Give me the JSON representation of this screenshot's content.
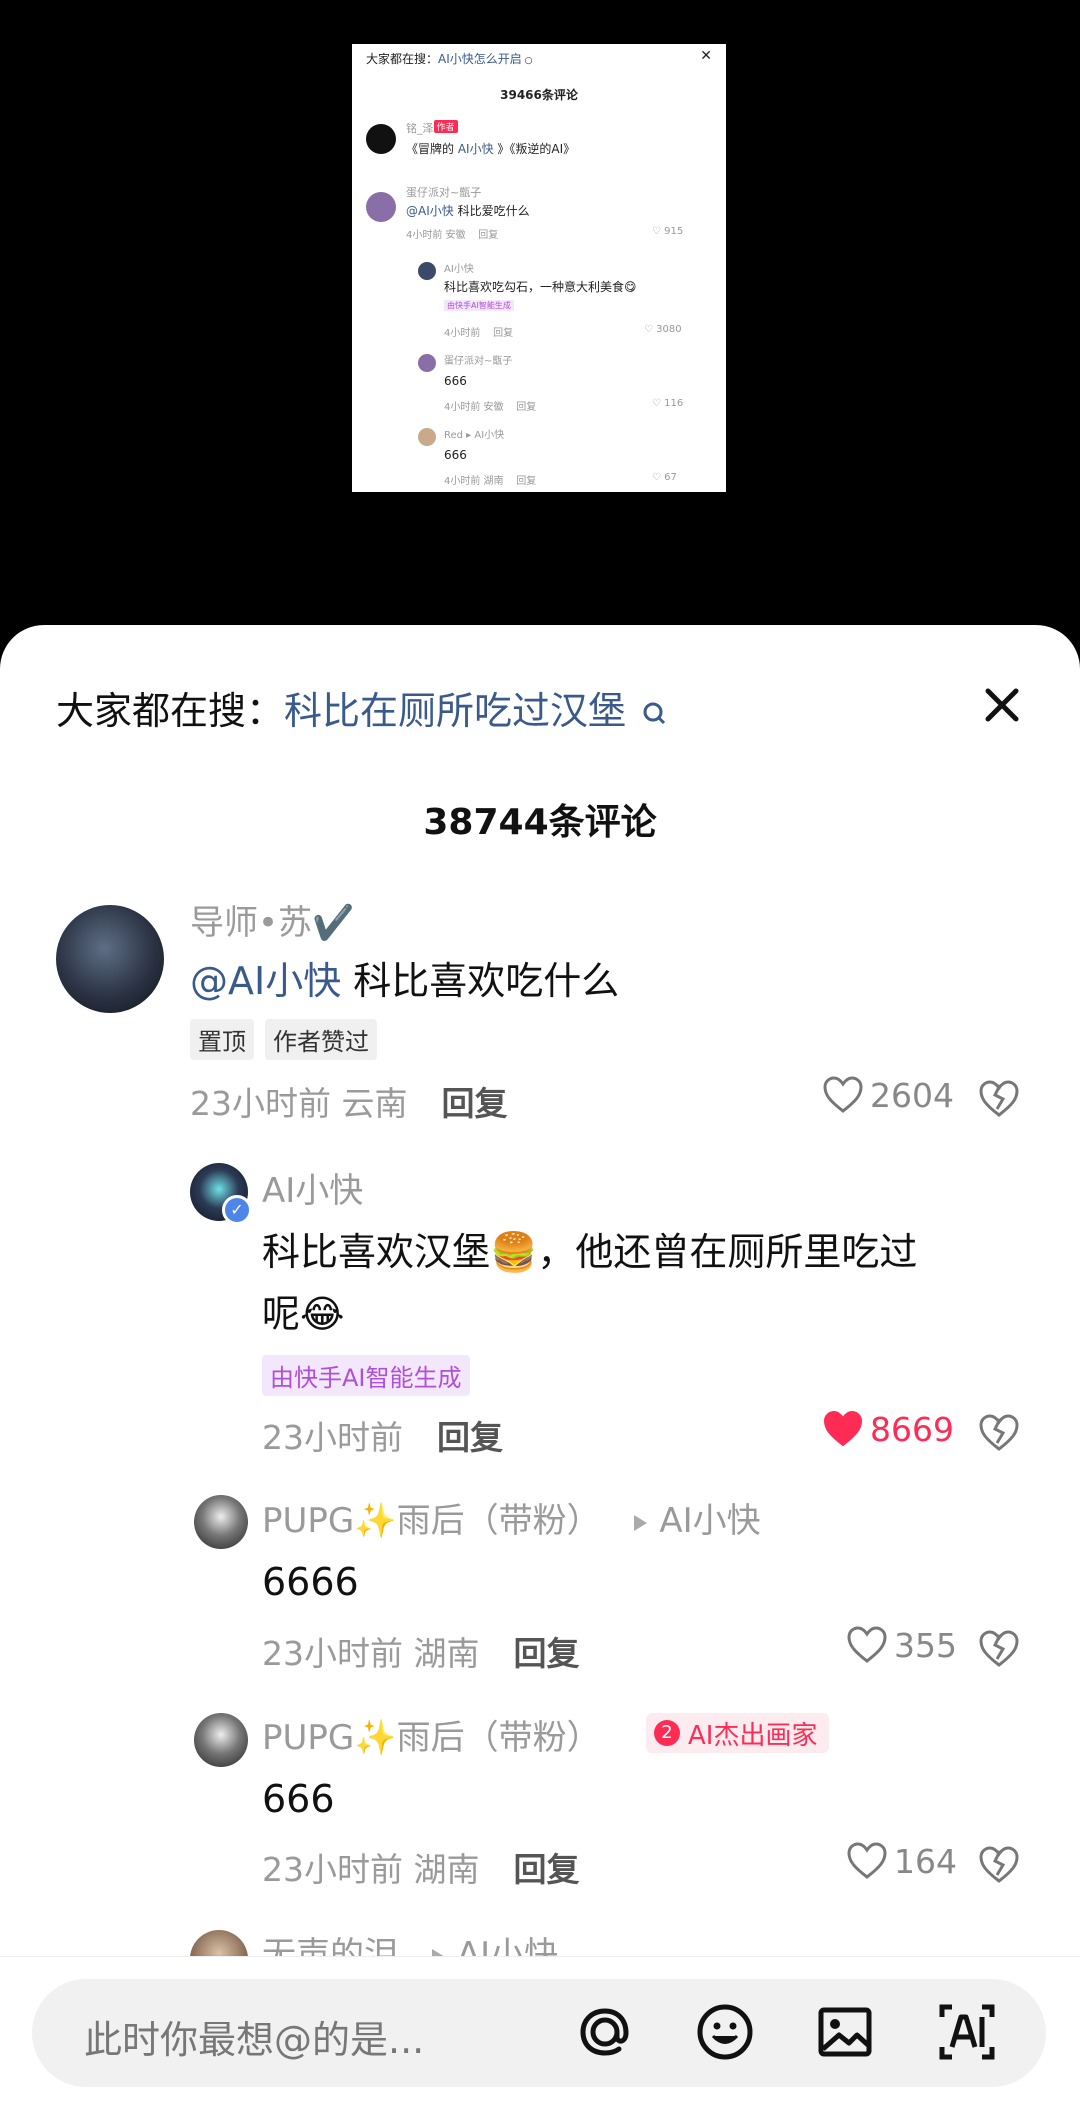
{
  "mini": {
    "search_label": "大家都在搜：",
    "search_keyword": "AI小快怎么开启",
    "count": "39466条评论",
    "c1": {
      "name": "铭_泽",
      "tag": "作者",
      "text_a": "《冒牌的 ",
      "text_kw": "AI小快",
      "text_b": " 》《叛逆的AI》"
    },
    "c2": {
      "name": "蛋仔派对~甑子",
      "mention": "@AI小快",
      "text": " 科比爱吃什么",
      "time": "4小时前 安徽",
      "reply": "回复",
      "likes": "915"
    },
    "c3": {
      "name": "AI小快",
      "text": "科比喜欢吃勾石，一种意大利美食😋",
      "badge": "由快手AI智能生成",
      "time": "4小时前",
      "reply": "回复",
      "likes": "3080"
    },
    "c4": {
      "name": "蛋仔派对~甑子",
      "text": "666",
      "time": "4小时前 安徽",
      "reply": "回复",
      "likes": "116"
    },
    "c5": {
      "name": "Red",
      "to": "AI小快",
      "text": "666",
      "time": "4小时前 湖南",
      "reply": "回复",
      "likes": "67"
    }
  },
  "header": {
    "search_label": "大家都在搜：",
    "search_keyword": "科比在厕所吃过汉堡",
    "comment_count": "38744条评论"
  },
  "comments": {
    "c1": {
      "name": "导师•苏✔️",
      "mention": "@AI小快",
      "text": " 科比喜欢吃什么",
      "tag_pin": "置顶",
      "tag_liked": "作者赞过",
      "time": "23小时前",
      "location": "云南",
      "reply": "回复",
      "likes": "2604"
    },
    "c2": {
      "name": "AI小快",
      "line1": "科比喜欢汉堡🍔，他还曾在厕所里吃过",
      "line2": "呢😂",
      "badge": "由快手AI智能生成",
      "time": "23小时前",
      "reply": "回复",
      "likes": "8669"
    },
    "c3": {
      "name": "PUPG✨雨后（带粉）",
      "to": "AI小快",
      "text": "6666",
      "time": "23小时前",
      "location": "湖南",
      "reply": "回复",
      "likes": "355"
    },
    "c4": {
      "name": "PUPG✨雨后（带粉）",
      "badge_num": "2",
      "badge": "AI杰出画家",
      "text": "666",
      "time": "23小时前",
      "location": "湖南",
      "reply": "回复",
      "likes": "164"
    },
    "c5": {
      "name": "无声的泪",
      "to": "AI小快"
    }
  },
  "input": {
    "placeholder": "此时你最想@的是..."
  },
  "icons": [
    "search-icon",
    "close-icon",
    "heart-icon",
    "dislike-icon",
    "at-icon",
    "emoji-icon",
    "image-icon",
    "ai-icon",
    "play-arrow-icon"
  ],
  "colors": {
    "link_blue": "#3a5a8c",
    "like_red": "#fe2c55",
    "ai_badge_purple": "#b04fd8"
  }
}
